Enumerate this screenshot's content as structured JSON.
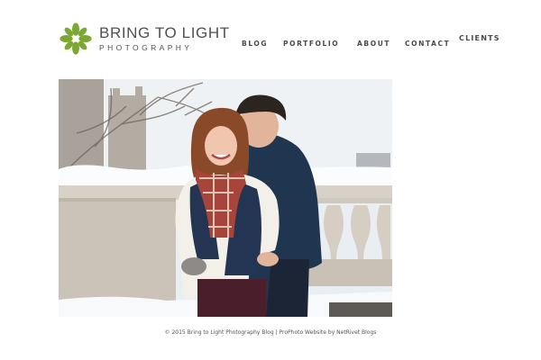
{
  "header": {
    "logo": {
      "title": "BRING TO LIGHT",
      "subtitle": "PHOTOGRAPHY",
      "mark_color": "#7aa832"
    },
    "nav": {
      "blog": "BLOG",
      "portfolio": "PORTFOLIO",
      "about": "ABOUT",
      "contact": "CONTACT",
      "clients": "CLIENTS"
    }
  },
  "hero": {
    "image": "engagement-photo"
  },
  "footer": {
    "copyright": "© 2015 Bring to Light Photography Blog",
    "separator": "|",
    "credit": "ProPhoto Website by NetRivet Blogs"
  }
}
